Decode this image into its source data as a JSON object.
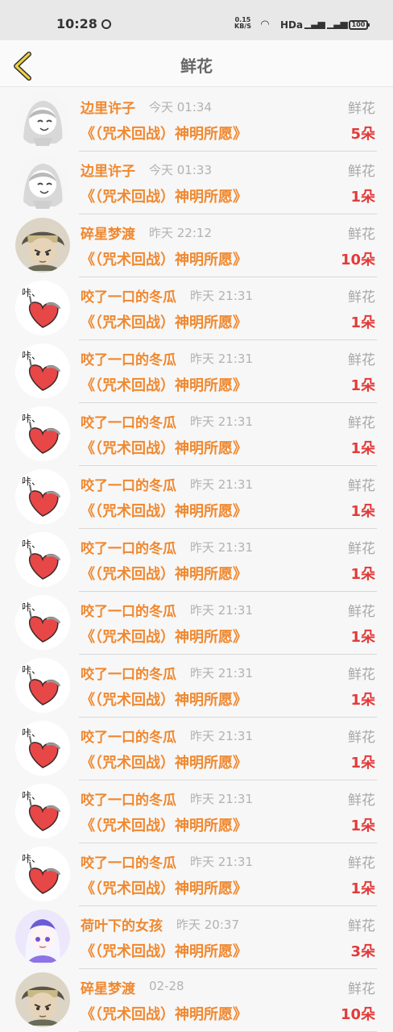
{
  "status_bar": {
    "time": "10:28",
    "speed_value": "0.15",
    "speed_unit": "KB/S",
    "hd": "HDa",
    "battery": "100",
    "icons": [
      "sync-icon",
      "wifi-icon",
      "signal-icon",
      "battery-icon"
    ]
  },
  "header": {
    "title": "鲜花",
    "back_icon": "chevron-left-icon",
    "accent": "#f0882f"
  },
  "colors": {
    "name": "#f0882f",
    "count": "#e33b3b",
    "muted": "#b2b2b2"
  },
  "gifts": [
    {
      "name": "边里许子",
      "time": "今天 01:34",
      "type": "鲜花",
      "book": "《（咒术回战）神明所愿》",
      "count": "5朵",
      "avatar": "anime-girl"
    },
    {
      "name": "边里许子",
      "time": "今天 01:33",
      "type": "鲜花",
      "book": "《（咒术回战）神明所愿》",
      "count": "1朵",
      "avatar": "anime-girl"
    },
    {
      "name": "碎星梦渡",
      "time": "昨天 22:12",
      "type": "鲜花",
      "book": "《（咒术回战）神明所愿》",
      "count": "10朵",
      "avatar": "anime-boy"
    },
    {
      "name": "咬了一口的冬瓜",
      "time": "昨天 21:31",
      "type": "鲜花",
      "book": "《（咒术回战）神明所愿》",
      "count": "1朵",
      "avatar": "heart"
    },
    {
      "name": "咬了一口的冬瓜",
      "time": "昨天 21:31",
      "type": "鲜花",
      "book": "《（咒术回战）神明所愿》",
      "count": "1朵",
      "avatar": "heart"
    },
    {
      "name": "咬了一口的冬瓜",
      "time": "昨天 21:31",
      "type": "鲜花",
      "book": "《（咒术回战）神明所愿》",
      "count": "1朵",
      "avatar": "heart"
    },
    {
      "name": "咬了一口的冬瓜",
      "time": "昨天 21:31",
      "type": "鲜花",
      "book": "《（咒术回战）神明所愿》",
      "count": "1朵",
      "avatar": "heart"
    },
    {
      "name": "咬了一口的冬瓜",
      "time": "昨天 21:31",
      "type": "鲜花",
      "book": "《（咒术回战）神明所愿》",
      "count": "1朵",
      "avatar": "heart"
    },
    {
      "name": "咬了一口的冬瓜",
      "time": "昨天 21:31",
      "type": "鲜花",
      "book": "《（咒术回战）神明所愿》",
      "count": "1朵",
      "avatar": "heart"
    },
    {
      "name": "咬了一口的冬瓜",
      "time": "昨天 21:31",
      "type": "鲜花",
      "book": "《（咒术回战）神明所愿》",
      "count": "1朵",
      "avatar": "heart"
    },
    {
      "name": "咬了一口的冬瓜",
      "time": "昨天 21:31",
      "type": "鲜花",
      "book": "《（咒术回战）神明所愿》",
      "count": "1朵",
      "avatar": "heart"
    },
    {
      "name": "咬了一口的冬瓜",
      "time": "昨天 21:31",
      "type": "鲜花",
      "book": "《（咒术回战）神明所愿》",
      "count": "1朵",
      "avatar": "heart"
    },
    {
      "name": "咬了一口的冬瓜",
      "time": "昨天 21:31",
      "type": "鲜花",
      "book": "《（咒术回战）神明所愿》",
      "count": "1朵",
      "avatar": "heart"
    },
    {
      "name": "荷叶下的女孩",
      "time": "昨天 20:37",
      "type": "鲜花",
      "book": "《（咒术回战）神明所愿》",
      "count": "3朵",
      "avatar": "purple-girl"
    },
    {
      "name": "碎星梦渡",
      "time": "02-28",
      "type": "鲜花",
      "book": "《（咒术回战）神明所愿》",
      "count": "10朵",
      "avatar": "anime-boy"
    }
  ]
}
